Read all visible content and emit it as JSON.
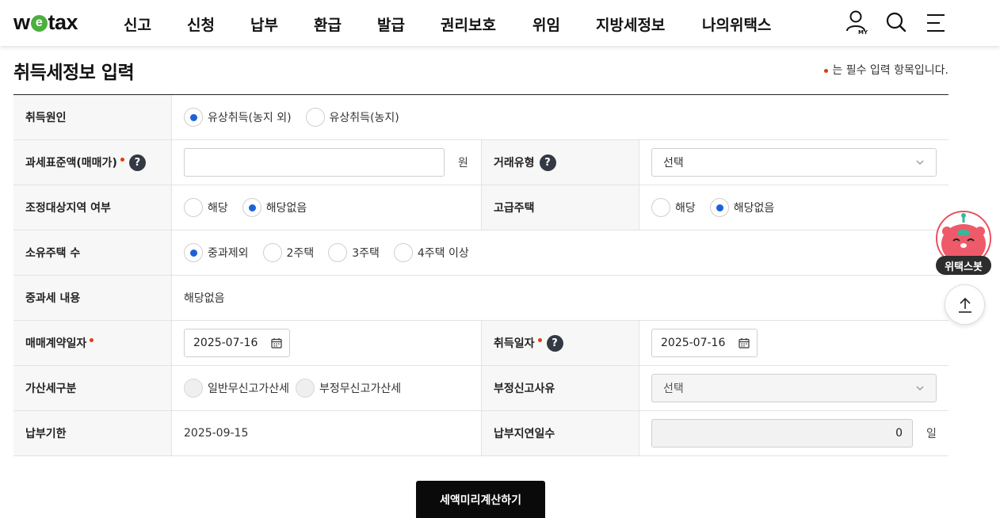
{
  "header": {
    "logo_text_1": "w",
    "logo_text_2": "e",
    "logo_text_3": "tax",
    "menu": [
      "신고",
      "신청",
      "납부",
      "환급",
      "발급",
      "권리보호",
      "위임",
      "지방세정보",
      "나의위택스"
    ],
    "my_icon_label": "MY"
  },
  "page": {
    "title": "취득세정보 입력",
    "required_note": "는 필수 입력 항목입니다."
  },
  "form": {
    "acquisition_cause": {
      "label": "취득원인",
      "options": [
        "유상취득(농지 외)",
        "유상취득(농지)"
      ],
      "selected": "유상취득(농지 외)"
    },
    "tax_base": {
      "label": "과세표준액(매매가)",
      "value": "",
      "unit": "원"
    },
    "transaction_type": {
      "label": "거래유형",
      "selected": "선택"
    },
    "adjusted_area": {
      "label": "조정대상지역 여부",
      "options": [
        "해당",
        "해당없음"
      ],
      "selected": "해당없음"
    },
    "luxury_house": {
      "label": "고급주택",
      "options": [
        "해당",
        "해당없음"
      ],
      "selected": "해당없음"
    },
    "houses_owned": {
      "label": "소유주택 수",
      "options": [
        "중과제외",
        "2주택",
        "3주택",
        "4주택 이상"
      ],
      "selected": "중과제외"
    },
    "heavy_tax": {
      "label": "중과세 내용",
      "value": "해당없음"
    },
    "contract_date": {
      "label": "매매계약일자",
      "value": "2025-07-16"
    },
    "acquisition_date": {
      "label": "취득일자",
      "value": "2025-07-16"
    },
    "penalty_type": {
      "label": "가산세구분",
      "options": [
        "일반무신고가산세",
        "부정무신고가산세"
      ]
    },
    "fraud_reason": {
      "label": "부정신고사유",
      "selected": "선택"
    },
    "due_date": {
      "label": "납부기한",
      "value": "2025-09-15"
    },
    "delay_days": {
      "label": "납부지연일수",
      "value": "0",
      "unit": "일"
    }
  },
  "actions": {
    "calculate": "세액미리계산하기"
  },
  "floating": {
    "bot_label": "위택스봇"
  },
  "colors": {
    "required": "#e03c0e",
    "radio_on": "#1a62d6",
    "logo_e": "#4cae3f",
    "bot": "#e8515f"
  }
}
